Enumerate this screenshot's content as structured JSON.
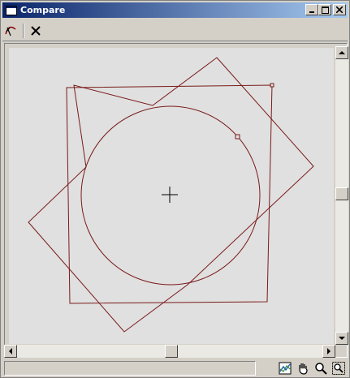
{
  "window": {
    "title": "Compare",
    "caption_buttons": [
      "minimize-icon",
      "maximize-icon",
      "close-icon"
    ]
  },
  "toolbar": {
    "items": [
      {
        "name": "pick-curve-button",
        "icon": "curve-pick-icon"
      },
      {
        "name": "delete-button",
        "icon": "x-close-icon"
      }
    ]
  },
  "viewport": {
    "background": "#e0e0e0",
    "shape_color": "#7a1a1a",
    "shapes": [
      "rotated-square",
      "square",
      "circle",
      "center-cross"
    ]
  },
  "scrollbars": {
    "vertical_position": 0.5,
    "horizontal_position": 0.5
  },
  "status": {
    "text": "",
    "tools": [
      "zoom-extents-icon",
      "pan-hand-icon",
      "zoom-icon",
      "zoom-region-icon"
    ]
  }
}
